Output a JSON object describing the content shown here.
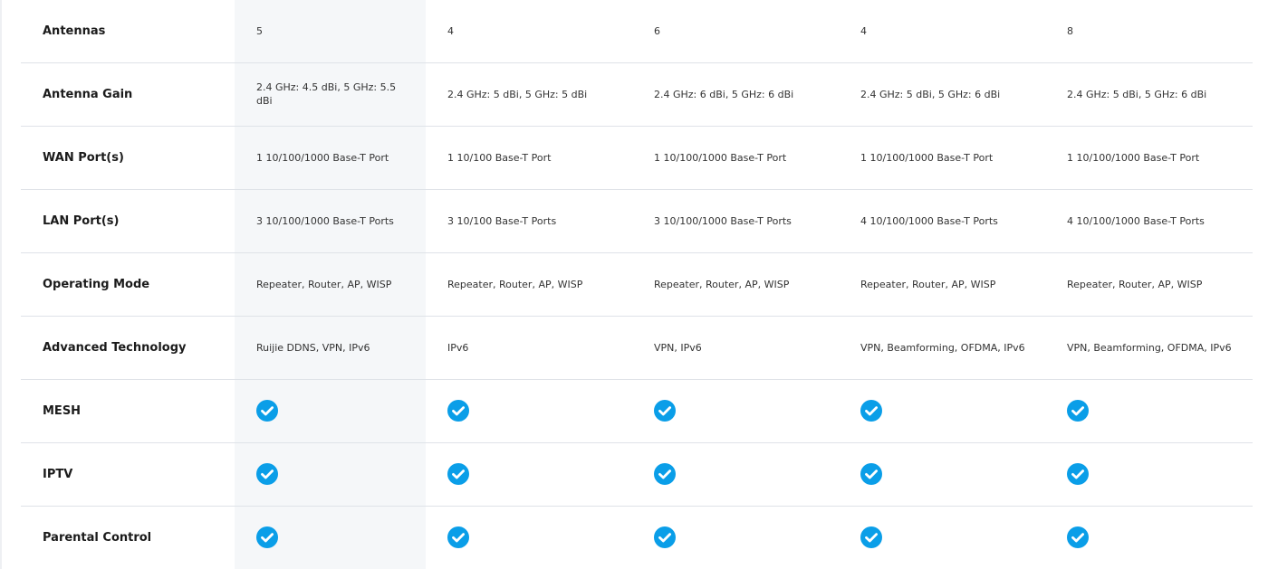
{
  "rows": [
    {
      "label": "Antennas",
      "values": [
        "5",
        "4",
        "6",
        "4",
        "8"
      ]
    },
    {
      "label": "Antenna Gain",
      "values": [
        "2.4 GHz: 4.5 dBi, 5 GHz: 5.5 dBi",
        "2.4 GHz: 5 dBi, 5 GHz: 5 dBi",
        "2.4 GHz: 6 dBi, 5 GHz: 6 dBi",
        "2.4 GHz: 5 dBi, 5 GHz: 6 dBi",
        "2.4 GHz: 5 dBi, 5 GHz: 6 dBi"
      ]
    },
    {
      "label": "WAN Port(s)",
      "values": [
        "1 10/100/1000 Base-T Port",
        "1 10/100 Base-T Port",
        "1 10/100/1000 Base-T Port",
        "1 10/100/1000 Base-T Port",
        "1 10/100/1000 Base-T Port"
      ]
    },
    {
      "label": "LAN Port(s)",
      "values": [
        "3 10/100/1000 Base-T Ports",
        "3 10/100 Base-T Ports",
        "3 10/100/1000 Base-T Ports",
        "4 10/100/1000 Base-T Ports",
        "4 10/100/1000 Base-T Ports"
      ]
    },
    {
      "label": "Operating Mode",
      "values": [
        "Repeater, Router, AP, WISP",
        "Repeater, Router, AP, WISP",
        "Repeater, Router, AP, WISP",
        "Repeater, Router, AP, WISP",
        "Repeater, Router, AP, WISP"
      ]
    },
    {
      "label": "Advanced Technology",
      "values": [
        "Ruijie DDNS, VPN, IPv6",
        "IPv6",
        "VPN, IPv6",
        "VPN, Beamforming, OFDMA, IPv6",
        "VPN, Beamforming, OFDMA, IPv6"
      ]
    },
    {
      "label": "MESH",
      "supported": [
        true,
        true,
        true,
        true,
        true
      ]
    },
    {
      "label": "IPTV",
      "supported": [
        true,
        true,
        true,
        true,
        true
      ]
    },
    {
      "label": "Parental Control",
      "supported": [
        true,
        true,
        true,
        true,
        true
      ]
    }
  ],
  "icons": {
    "supported": "check-circle-icon"
  },
  "colors": {
    "check": "#0a9ee8",
    "highlight_column": "#f5f7f9",
    "divider": "#dfe3e8"
  }
}
